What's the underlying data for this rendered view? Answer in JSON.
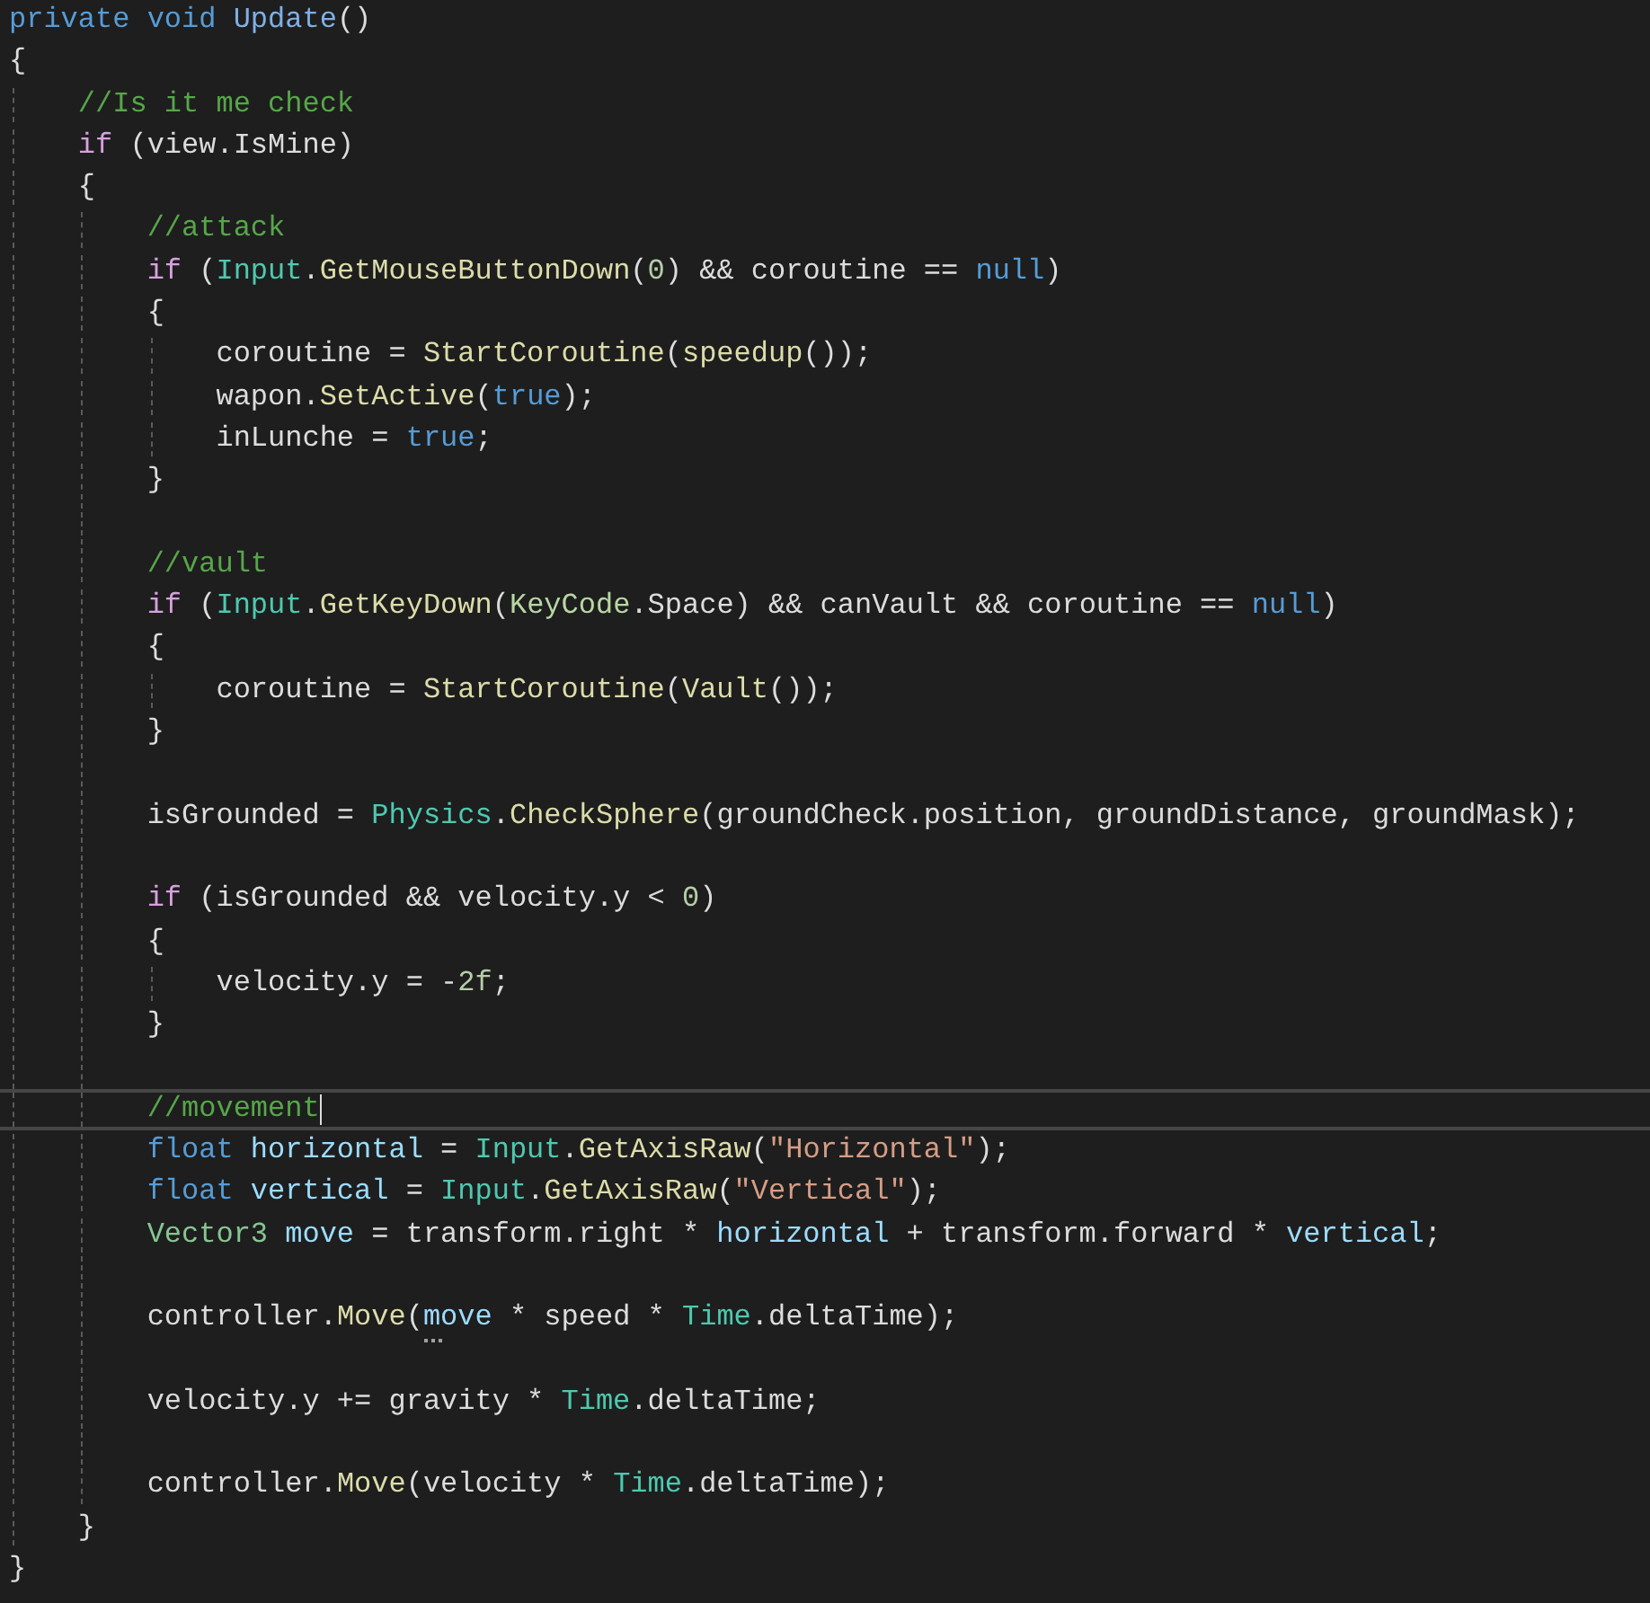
{
  "editor": {
    "lines": [
      {
        "kind": "code",
        "current": false,
        "tokens": [
          {
            "text": "private void ",
            "kind": "keyword"
          },
          {
            "text": "Update",
            "kind": "declaration"
          },
          {
            "text": "()",
            "kind": "plain"
          }
        ]
      },
      {
        "kind": "code",
        "current": false,
        "tokens": [
          {
            "text": "{",
            "kind": "plain"
          }
        ],
        "children": [
          {
            "kind": "code",
            "current": false,
            "tokens": [
              {
                "text": "//Is it me check",
                "kind": "comment"
              }
            ]
          },
          {
            "kind": "code",
            "current": false,
            "tokens": [
              {
                "text": "if",
                "kind": "control"
              },
              {
                "text": " (view.IsMine)",
                "kind": "plain"
              }
            ]
          },
          {
            "kind": "code",
            "current": false,
            "tokens": [
              {
                "text": "{",
                "kind": "plain"
              }
            ],
            "children": [
              {
                "kind": "code",
                "current": false,
                "tokens": [
                  {
                    "text": "//attack",
                    "kind": "comment"
                  }
                ]
              },
              {
                "kind": "code",
                "current": false,
                "tokens": [
                  {
                    "text": "if",
                    "kind": "control"
                  },
                  {
                    "text": " (",
                    "kind": "plain"
                  },
                  {
                    "text": "Input",
                    "kind": "type"
                  },
                  {
                    "text": ".",
                    "kind": "plain"
                  },
                  {
                    "text": "GetMouseButtonDown",
                    "kind": "method"
                  },
                  {
                    "text": "(",
                    "kind": "plain"
                  },
                  {
                    "text": "0",
                    "kind": "number"
                  },
                  {
                    "text": ") && coroutine == ",
                    "kind": "plain"
                  },
                  {
                    "text": "null",
                    "kind": "keyword"
                  },
                  {
                    "text": ")",
                    "kind": "plain"
                  }
                ]
              },
              {
                "kind": "code",
                "current": false,
                "tokens": [
                  {
                    "text": "{",
                    "kind": "plain"
                  }
                ],
                "children": [
                  {
                    "kind": "code",
                    "current": false,
                    "tokens": [
                      {
                        "text": "coroutine = ",
                        "kind": "plain"
                      },
                      {
                        "text": "StartCoroutine",
                        "kind": "method"
                      },
                      {
                        "text": "(",
                        "kind": "plain"
                      },
                      {
                        "text": "speedup",
                        "kind": "method"
                      },
                      {
                        "text": "());",
                        "kind": "plain"
                      }
                    ]
                  },
                  {
                    "kind": "code",
                    "current": false,
                    "tokens": [
                      {
                        "text": "wapon.",
                        "kind": "plain"
                      },
                      {
                        "text": "SetActive",
                        "kind": "method"
                      },
                      {
                        "text": "(",
                        "kind": "plain"
                      },
                      {
                        "text": "true",
                        "kind": "keyword"
                      },
                      {
                        "text": ");",
                        "kind": "plain"
                      }
                    ]
                  },
                  {
                    "kind": "code",
                    "current": false,
                    "tokens": [
                      {
                        "text": "inLunche = ",
                        "kind": "plain"
                      },
                      {
                        "text": "true",
                        "kind": "keyword"
                      },
                      {
                        "text": ";",
                        "kind": "plain"
                      }
                    ]
                  }
                ]
              },
              {
                "kind": "code",
                "current": false,
                "tokens": [
                  {
                    "text": "}",
                    "kind": "plain"
                  }
                ]
              },
              {
                "kind": "blank"
              },
              {
                "kind": "code",
                "current": false,
                "tokens": [
                  {
                    "text": "//vault",
                    "kind": "comment"
                  }
                ]
              },
              {
                "kind": "code",
                "current": false,
                "tokens": [
                  {
                    "text": "if",
                    "kind": "control"
                  },
                  {
                    "text": " (",
                    "kind": "plain"
                  },
                  {
                    "text": "Input",
                    "kind": "type"
                  },
                  {
                    "text": ".",
                    "kind": "plain"
                  },
                  {
                    "text": "GetKeyDown",
                    "kind": "method"
                  },
                  {
                    "text": "(",
                    "kind": "plain"
                  },
                  {
                    "text": "KeyCode",
                    "kind": "enum"
                  },
                  {
                    "text": ".Space) && canVault && coroutine == ",
                    "kind": "plain"
                  },
                  {
                    "text": "null",
                    "kind": "keyword"
                  },
                  {
                    "text": ")",
                    "kind": "plain"
                  }
                ]
              },
              {
                "kind": "code",
                "current": false,
                "tokens": [
                  {
                    "text": "{",
                    "kind": "plain"
                  }
                ],
                "children": [
                  {
                    "kind": "code",
                    "current": false,
                    "tokens": [
                      {
                        "text": "coroutine = ",
                        "kind": "plain"
                      },
                      {
                        "text": "StartCoroutine",
                        "kind": "method"
                      },
                      {
                        "text": "(",
                        "kind": "plain"
                      },
                      {
                        "text": "Vault",
                        "kind": "method"
                      },
                      {
                        "text": "());",
                        "kind": "plain"
                      }
                    ]
                  }
                ]
              },
              {
                "kind": "code",
                "current": false,
                "tokens": [
                  {
                    "text": "}",
                    "kind": "plain"
                  }
                ]
              },
              {
                "kind": "blank"
              },
              {
                "kind": "code",
                "current": false,
                "tokens": [
                  {
                    "text": "isGrounded = ",
                    "kind": "plain"
                  },
                  {
                    "text": "Physics",
                    "kind": "type"
                  },
                  {
                    "text": ".",
                    "kind": "plain"
                  },
                  {
                    "text": "CheckSphere",
                    "kind": "method"
                  },
                  {
                    "text": "(groundCheck.position, groundDistance, groundMask);",
                    "kind": "plain"
                  }
                ]
              },
              {
                "kind": "blank"
              },
              {
                "kind": "code",
                "current": false,
                "tokens": [
                  {
                    "text": "if",
                    "kind": "control"
                  },
                  {
                    "text": " (isGrounded && velocity.y < ",
                    "kind": "plain"
                  },
                  {
                    "text": "0",
                    "kind": "number"
                  },
                  {
                    "text": ")",
                    "kind": "plain"
                  }
                ]
              },
              {
                "kind": "code",
                "current": false,
                "tokens": [
                  {
                    "text": "{",
                    "kind": "plain"
                  }
                ],
                "children": [
                  {
                    "kind": "code",
                    "current": false,
                    "tokens": [
                      {
                        "text": "velocity.y = -",
                        "kind": "plain"
                      },
                      {
                        "text": "2f",
                        "kind": "number"
                      },
                      {
                        "text": ";",
                        "kind": "plain"
                      }
                    ]
                  }
                ]
              },
              {
                "kind": "code",
                "current": false,
                "tokens": [
                  {
                    "text": "}",
                    "kind": "plain"
                  }
                ]
              },
              {
                "kind": "blank"
              },
              {
                "kind": "code",
                "current": true,
                "tokens": [
                  {
                    "text": "//movement",
                    "kind": "comment"
                  }
                ]
              },
              {
                "kind": "code",
                "current": false,
                "tokens": [
                  {
                    "text": "float ",
                    "kind": "keyword"
                  },
                  {
                    "text": "horizontal",
                    "kind": "local"
                  },
                  {
                    "text": " = ",
                    "kind": "plain"
                  },
                  {
                    "text": "Input",
                    "kind": "type"
                  },
                  {
                    "text": ".",
                    "kind": "plain"
                  },
                  {
                    "text": "GetAxisRaw",
                    "kind": "method"
                  },
                  {
                    "text": "(",
                    "kind": "plain"
                  },
                  {
                    "text": "\"Horizontal\"",
                    "kind": "string"
                  },
                  {
                    "text": ");",
                    "kind": "plain"
                  }
                ]
              },
              {
                "kind": "code",
                "current": false,
                "tokens": [
                  {
                    "text": "float ",
                    "kind": "keyword"
                  },
                  {
                    "text": "vertical",
                    "kind": "local"
                  },
                  {
                    "text": " = ",
                    "kind": "plain"
                  },
                  {
                    "text": "Input",
                    "kind": "type"
                  },
                  {
                    "text": ".",
                    "kind": "plain"
                  },
                  {
                    "text": "GetAxisRaw",
                    "kind": "method"
                  },
                  {
                    "text": "(",
                    "kind": "plain"
                  },
                  {
                    "text": "\"Vertical\"",
                    "kind": "string"
                  },
                  {
                    "text": ");",
                    "kind": "plain"
                  }
                ]
              },
              {
                "kind": "code",
                "current": false,
                "tokens": [
                  {
                    "text": "Vector3 ",
                    "kind": "struct"
                  },
                  {
                    "text": "move",
                    "kind": "local"
                  },
                  {
                    "text": " = transform.right * ",
                    "kind": "plain"
                  },
                  {
                    "text": "horizontal",
                    "kind": "local"
                  },
                  {
                    "text": " + transform.forward * ",
                    "kind": "plain"
                  },
                  {
                    "text": "vertical",
                    "kind": "local"
                  },
                  {
                    "text": ";",
                    "kind": "plain"
                  }
                ]
              },
              {
                "kind": "blank"
              },
              {
                "kind": "code",
                "current": false,
                "tokens": [
                  {
                    "text": "controller.",
                    "kind": "plain"
                  },
                  {
                    "text": "Move",
                    "kind": "method"
                  },
                  {
                    "text": "(",
                    "kind": "plain"
                  },
                  {
                    "text": "move",
                    "kind": "local",
                    "hint": true
                  },
                  {
                    "text": " * speed * ",
                    "kind": "plain"
                  },
                  {
                    "text": "Time",
                    "kind": "type"
                  },
                  {
                    "text": ".deltaTime);",
                    "kind": "plain"
                  }
                ]
              },
              {
                "kind": "blank"
              },
              {
                "kind": "code",
                "current": false,
                "tokens": [
                  {
                    "text": "velocity.y += gravity * ",
                    "kind": "plain"
                  },
                  {
                    "text": "Time",
                    "kind": "type"
                  },
                  {
                    "text": ".deltaTime;",
                    "kind": "plain"
                  }
                ]
              },
              {
                "kind": "blank"
              },
              {
                "kind": "code",
                "current": false,
                "tokens": [
                  {
                    "text": "controller.",
                    "kind": "plain"
                  },
                  {
                    "text": "Move",
                    "kind": "method"
                  },
                  {
                    "text": "(velocity * ",
                    "kind": "plain"
                  },
                  {
                    "text": "Time",
                    "kind": "type"
                  },
                  {
                    "text": ".deltaTime);",
                    "kind": "plain"
                  }
                ]
              }
            ]
          },
          {
            "kind": "code",
            "current": false,
            "tokens": [
              {
                "text": "}",
                "kind": "plain"
              }
            ]
          }
        ]
      },
      {
        "kind": "code",
        "current": false,
        "tokens": [
          {
            "text": "}",
            "kind": "plain"
          }
        ]
      }
    ]
  }
}
